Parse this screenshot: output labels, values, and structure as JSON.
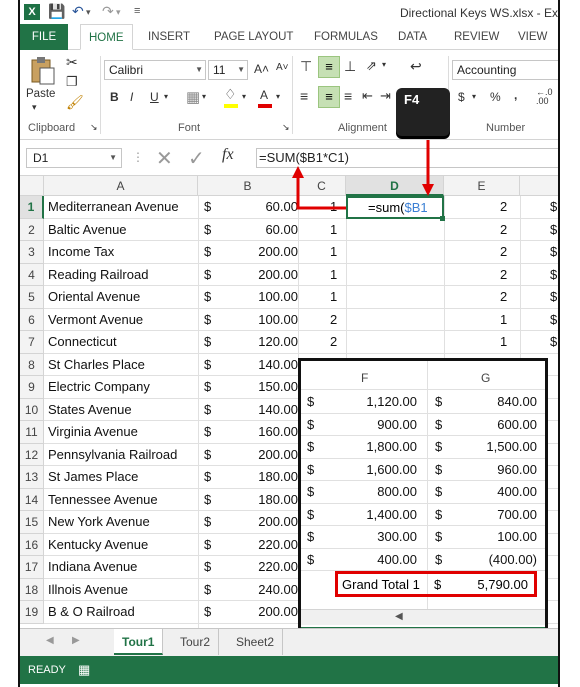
{
  "title": {
    "window_title": "Directional Keys WS.xlsx - Ex"
  },
  "ribbon": {
    "tabs": [
      "FILE",
      "HOME",
      "INSERT",
      "PAGE LAYOUT",
      "FORMULAS",
      "DATA",
      "REVIEW",
      "VIEW"
    ],
    "paste_label": "Paste",
    "font_name": "Calibri",
    "font_size": "11",
    "number_format": "Accounting",
    "groups": [
      "Clipboard",
      "Font",
      "Alignment",
      "Number"
    ],
    "key_label": "F4",
    "bold": "B",
    "italic": "I",
    "underline": "U",
    "grow_font": "A˄",
    "shrink_font": "A˅",
    "font_color": "A",
    "currency": "$",
    "percent": "%",
    "comma": ","
  },
  "formula_bar": {
    "name_box": "D1",
    "fx": "fx",
    "formula": "=SUM($B1*C1)"
  },
  "grid": {
    "columns": [
      "A",
      "B",
      "C",
      "D",
      "E"
    ],
    "active_cell_text": "=sum(",
    "active_cell_ref": "$B1",
    "rows": [
      {
        "n": "1",
        "a": "Mediterranean Avenue",
        "cur": "$",
        "b": "60.00",
        "c": "1",
        "e": "2",
        "f": "$"
      },
      {
        "n": "2",
        "a": "Baltic Avenue",
        "cur": "$",
        "b": "60.00",
        "c": "1",
        "e": "2",
        "f": "$"
      },
      {
        "n": "3",
        "a": "Income Tax",
        "cur": "$",
        "b": "200.00",
        "c": "1",
        "e": "2",
        "f": "$"
      },
      {
        "n": "4",
        "a": "Reading Railroad",
        "cur": "$",
        "b": "200.00",
        "c": "1",
        "e": "2",
        "f": "$"
      },
      {
        "n": "5",
        "a": "Oriental Avenue",
        "cur": "$",
        "b": "100.00",
        "c": "1",
        "e": "2",
        "f": "$"
      },
      {
        "n": "6",
        "a": "Vermont Avenue",
        "cur": "$",
        "b": "100.00",
        "c": "2",
        "e": "1",
        "f": "$"
      },
      {
        "n": "7",
        "a": "Connecticut",
        "cur": "$",
        "b": "120.00",
        "c": "2",
        "e": "1",
        "f": "$"
      },
      {
        "n": "8",
        "a": "St Charles Place",
        "cur": "$",
        "b": "140.00",
        "c": "",
        "e": "",
        "f": ""
      },
      {
        "n": "9",
        "a": "Electric Company",
        "cur": "$",
        "b": "150.00",
        "c": "",
        "e": "",
        "f": ""
      },
      {
        "n": "10",
        "a": "States Avenue",
        "cur": "$",
        "b": "140.00",
        "c": "",
        "e": "",
        "f": ""
      },
      {
        "n": "11",
        "a": "Virginia Avenue",
        "cur": "$",
        "b": "160.00",
        "c": "",
        "e": "",
        "f": ""
      },
      {
        "n": "12",
        "a": "Pennsylvania Railroad",
        "cur": "$",
        "b": "200.00",
        "c": "",
        "e": "",
        "f": ""
      },
      {
        "n": "13",
        "a": "St James Place",
        "cur": "$",
        "b": "180.00",
        "c": "",
        "e": "",
        "f": ""
      },
      {
        "n": "14",
        "a": "Tennessee Avenue",
        "cur": "$",
        "b": "180.00",
        "c": "",
        "e": "",
        "f": ""
      },
      {
        "n": "15",
        "a": "New York Avenue",
        "cur": "$",
        "b": "200.00",
        "c": "",
        "e": "",
        "f": ""
      },
      {
        "n": "16",
        "a": "Kentucky Avenue",
        "cur": "$",
        "b": "220.00",
        "c": "",
        "e": "",
        "f": ""
      },
      {
        "n": "17",
        "a": "Indiana Avenue",
        "cur": "$",
        "b": "220.00",
        "c": "",
        "e": "",
        "f": ""
      },
      {
        "n": "18",
        "a": "Illnois Avenue",
        "cur": "$",
        "b": "240.00",
        "c": "",
        "e": "",
        "f": ""
      },
      {
        "n": "19",
        "a": "B & O Railroad",
        "cur": "$",
        "b": "200.00",
        "c": "",
        "e": "",
        "f": ""
      }
    ]
  },
  "inset": {
    "columns": [
      "F",
      "G"
    ],
    "rows": [
      {
        "cf": "$",
        "f": "1,120.00",
        "cg": "$",
        "g": "840.00"
      },
      {
        "cf": "$",
        "f": "900.00",
        "cg": "$",
        "g": "600.00"
      },
      {
        "cf": "$",
        "f": "1,800.00",
        "cg": "$",
        "g": "1,500.00"
      },
      {
        "cf": "$",
        "f": "1,600.00",
        "cg": "$",
        "g": "960.00"
      },
      {
        "cf": "$",
        "f": "800.00",
        "cg": "$",
        "g": "400.00"
      },
      {
        "cf": "$",
        "f": "1,400.00",
        "cg": "$",
        "g": "700.00"
      },
      {
        "cf": "$",
        "f": "300.00",
        "cg": "$",
        "g": "100.00"
      },
      {
        "cf": "$",
        "f": "400.00",
        "cg": "$",
        "g": "(400.00)"
      }
    ],
    "total_label": "Grand Total 1",
    "total_currency": "$",
    "total_value": "5,790.00"
  },
  "sheets": {
    "tabs": [
      "Tour1",
      "Tour2",
      "Sheet2"
    ],
    "active": "Tour1"
  },
  "status": {
    "ready": "READY"
  },
  "colors": {
    "accent": "#217346",
    "highlight": "#e00000"
  }
}
